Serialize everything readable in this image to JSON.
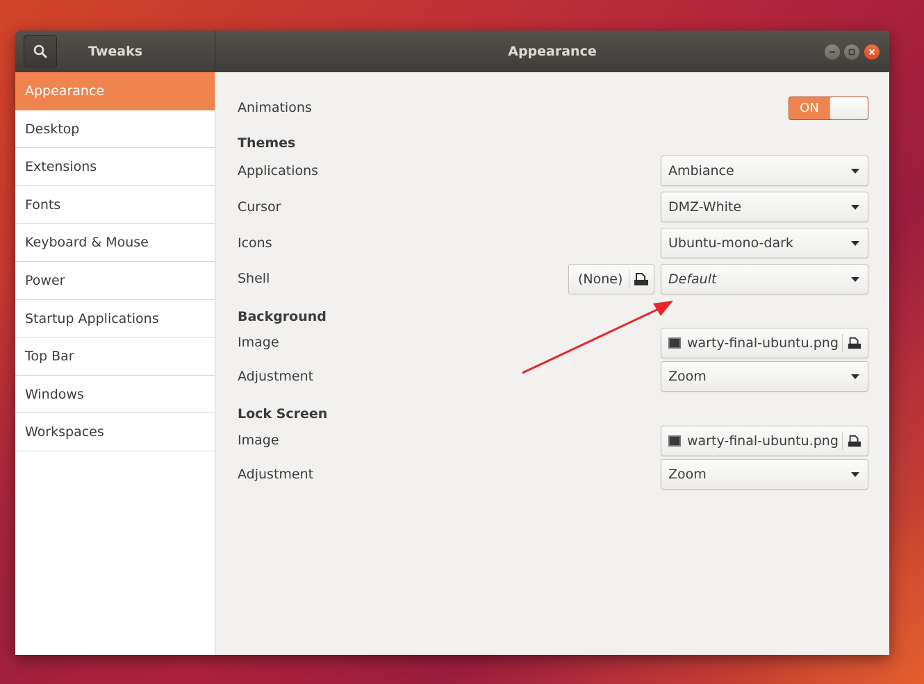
{
  "colors": {
    "accent": "#f0844f",
    "annotation_arrow": "#e8262b"
  },
  "titlebar": {
    "app_title": "Tweaks",
    "window_title": "Appearance",
    "search_icon": "search-icon"
  },
  "sidebar": {
    "items": [
      {
        "label": "Appearance",
        "active": true
      },
      {
        "label": "Desktop"
      },
      {
        "label": "Extensions"
      },
      {
        "label": "Fonts"
      },
      {
        "label": "Keyboard & Mouse"
      },
      {
        "label": "Power"
      },
      {
        "label": "Startup Applications"
      },
      {
        "label": "Top Bar"
      },
      {
        "label": "Windows"
      },
      {
        "label": "Workspaces"
      }
    ]
  },
  "main": {
    "animations": {
      "label": "Animations",
      "toggle_label": "ON",
      "enabled": true
    },
    "themes": {
      "heading": "Themes",
      "applications": {
        "label": "Applications",
        "value": "Ambiance"
      },
      "cursor": {
        "label": "Cursor",
        "value": "DMZ-White"
      },
      "icons": {
        "label": "Icons",
        "value": "Ubuntu-mono-dark"
      },
      "shell": {
        "label": "Shell",
        "clear_label": "(None)",
        "value": "Default"
      }
    },
    "background": {
      "heading": "Background",
      "image": {
        "label": "Image",
        "file": "warty-final-ubuntu.png"
      },
      "adjustment": {
        "label": "Adjustment",
        "value": "Zoom"
      }
    },
    "lock_screen": {
      "heading": "Lock Screen",
      "image": {
        "label": "Image",
        "file": "warty-final-ubuntu.png"
      },
      "adjustment": {
        "label": "Adjustment",
        "value": "Zoom"
      }
    }
  }
}
